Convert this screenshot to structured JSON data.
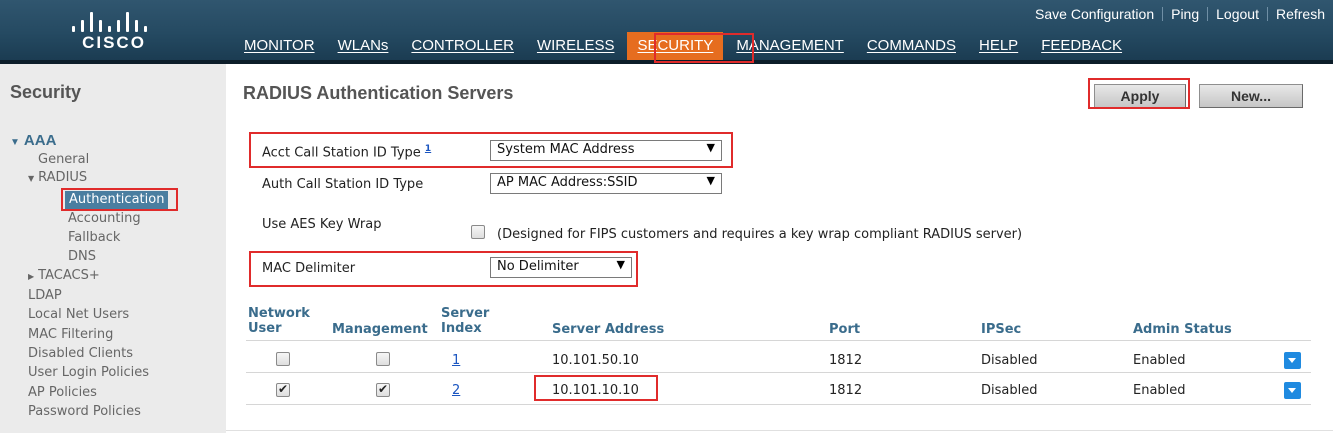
{
  "header": {
    "logo_text": "CISCO",
    "top_links": [
      "Save Configuration",
      "Ping",
      "Logout",
      "Refresh"
    ],
    "nav": [
      {
        "label": "MONITOR"
      },
      {
        "label": "WLANs"
      },
      {
        "label": "CONTROLLER"
      },
      {
        "label": "WIRELESS"
      },
      {
        "label": "SECURITY",
        "active": true
      },
      {
        "label": "MANAGEMENT"
      },
      {
        "label": "COMMANDS"
      },
      {
        "label": "HELP"
      },
      {
        "label": "FEEDBACK"
      }
    ]
  },
  "sidebar": {
    "title": "Security",
    "aaa_label": "AAA",
    "items": {
      "general": "General",
      "radius": "RADIUS",
      "authentication": "Authentication",
      "accounting": "Accounting",
      "fallback": "Fallback",
      "dns": "DNS",
      "tacacs": "TACACS+",
      "ldap": "LDAP",
      "local_net_users": "Local Net Users",
      "mac_filtering": "MAC Filtering",
      "disabled_clients": "Disabled Clients",
      "user_login_policies": "User Login Policies",
      "ap_policies": "AP Policies",
      "password_policies": "Password Policies"
    }
  },
  "main": {
    "title": "RADIUS Authentication Servers",
    "apply_label": "Apply",
    "new_label": "New...",
    "form": {
      "acct_label": "Acct Call Station ID Type",
      "acct_footnote": "1",
      "acct_value": "System MAC Address",
      "auth_label": "Auth Call Station ID Type",
      "auth_value": "AP MAC Address:SSID",
      "aes_label": "Use AES Key Wrap",
      "aes_note": "(Designed for FIPS customers and requires a key wrap compliant RADIUS server)",
      "mac_label": "MAC Delimiter",
      "mac_value": "No Delimiter"
    },
    "table": {
      "headers": {
        "network_user_1": "Network",
        "network_user_2": "User",
        "management": "Management",
        "server_index_1": "Server",
        "server_index_2": "Index",
        "server_address": "Server Address",
        "port": "Port",
        "ipsec": "IPSec",
        "admin_status": "Admin Status"
      },
      "rows": [
        {
          "network_user": false,
          "management": false,
          "index": "1",
          "address": "10.101.50.10",
          "port": "1812",
          "ipsec": "Disabled",
          "status": "Enabled"
        },
        {
          "network_user": true,
          "management": true,
          "index": "2",
          "address": "10.101.10.10",
          "port": "1812",
          "ipsec": "Disabled",
          "status": "Enabled"
        }
      ]
    }
  },
  "colors": {
    "header_bg": "#254a62",
    "nav_active": "#e66d1f",
    "highlight_box": "#e02b2b",
    "sidebar_selected": "#4a7ea0",
    "table_header": "#3a6c8c",
    "link": "#1a55c0",
    "dropdown_button": "#1f8ae0"
  },
  "icons": [
    "cisco-logo",
    "triangle-down-icon",
    "triangle-right-icon",
    "select-arrow-icon",
    "checkbox",
    "chevron-down-icon"
  ]
}
